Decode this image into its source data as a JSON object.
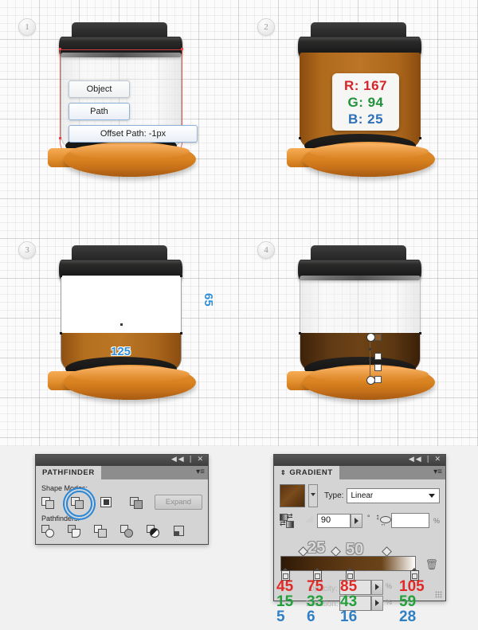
{
  "canvas": {
    "background_color": "#fbfbfb",
    "grid_color": "#969696"
  },
  "steps": [
    {
      "number": "1"
    },
    {
      "number": "2"
    },
    {
      "number": "3"
    },
    {
      "number": "4"
    }
  ],
  "panel1": {
    "name": "offset-path-step",
    "menu_chips": [
      {
        "label": "Object",
        "selected": false
      },
      {
        "label": "Path",
        "selected": true
      },
      {
        "label": "Offset Path: -1px",
        "selected": true
      }
    ],
    "path_outline_color": "#e84646"
  },
  "panel2": {
    "name": "fill-color-step",
    "readout": {
      "r": "R: 167",
      "g": "G: 94",
      "b": "B: 25",
      "r_color": "#d5232a",
      "g_color": "#21913c",
      "b_color": "#2d6fb8"
    },
    "jar_fill_color": "#bc7526"
  },
  "panel3": {
    "name": "rectangle-dimensions-step",
    "width_label": "125",
    "height_label": "65",
    "label_color": "#2f8fd8"
  },
  "panel4": {
    "name": "gradient-applied-step",
    "gradient_from": "#3e2209",
    "gradient_to": "#6d4316"
  },
  "pathfinder_panel": {
    "title": "PATHFINDER",
    "titlebar_controls": "◀◀ | ✕",
    "menu_icon": "panel-menu-icon",
    "shape_modes_label": "Shape Modes:",
    "shape_modes": [
      {
        "name": "unite",
        "selected": false
      },
      {
        "name": "minus-front",
        "selected": true
      },
      {
        "name": "intersect",
        "selected": false
      },
      {
        "name": "exclude",
        "selected": false
      }
    ],
    "expand_button": "Expand",
    "pathfinders_label": "Pathfinders:",
    "pathfinders": [
      {
        "name": "divide"
      },
      {
        "name": "trim"
      },
      {
        "name": "merge"
      },
      {
        "name": "crop"
      },
      {
        "name": "outline"
      },
      {
        "name": "minus-back"
      }
    ],
    "selection_ring_color": "#2b86d6"
  },
  "gradient_panel": {
    "title": "GRADIENT",
    "titlebar_controls": "◀◀ | ✕",
    "swatch_color": "#5b3411",
    "type_label": "Type:",
    "type_value": "Linear",
    "angle_value": "90",
    "angle_unit": "°",
    "aspect_value": "",
    "aspect_unit": "%",
    "overlay_numbers": [
      "25",
      "50"
    ],
    "opacity_label": "Opacity:",
    "opacity_value": "",
    "opacity_unit": "%",
    "location_label": "Location:",
    "location_value": "",
    "location_unit": "%",
    "delete_icon": "trash-icon",
    "stops": [
      {
        "r": "45",
        "g": "15",
        "b": "5"
      },
      {
        "r": "75",
        "g": "33",
        "b": "6"
      },
      {
        "r": "85",
        "g": "43",
        "b": "16"
      },
      {
        "r": "105",
        "g": "59",
        "b": "28"
      }
    ],
    "stop_colors": {
      "r": "#e02a27",
      "g": "#23a03c",
      "b": "#2e7fc4"
    }
  }
}
